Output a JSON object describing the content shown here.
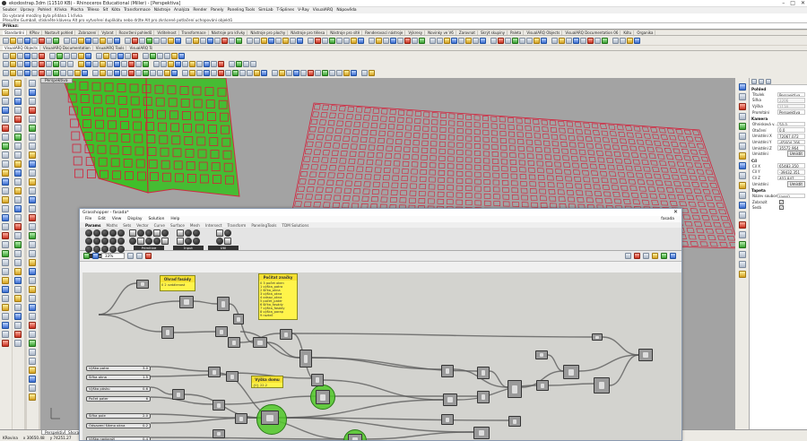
{
  "window": {
    "title": "ekodostrap.3dm (11510 KB) - Rhinoceros Educational (Miller) - [Perspektiva]",
    "controls": [
      "–",
      "□",
      "✕"
    ]
  },
  "menu": [
    "Soubor",
    "Úpravy",
    "Pohled",
    "Křivka",
    "Plocha",
    "Těleso",
    "Síť",
    "Kóta",
    "Transformace",
    "Nástroje",
    "Analýza",
    "Render",
    "Panely",
    "Paneling Tools",
    "SimLab",
    "T-Splines",
    "V-Ray",
    "VisualARQ",
    "Nápověda"
  ],
  "command": {
    "history": [
      "Do vybrané množiny byla přidána 1 křivka",
      "Přesuňte Gumball, stiskněte klávesu Alt pro vytvoření duplikátu nebo držte Alt pro zkrácené potlačení uchopování objektů"
    ],
    "prompt": "Příkaz:"
  },
  "tabs_row1": [
    "Standardní",
    "KPlov",
    "Nastavit pohled",
    "Zobrazení",
    "Vybrat",
    "Rozvržení pohledů",
    "Viditelnost",
    "Transformace",
    "Nástroje pro křivky",
    "Nástroje pro plochy",
    "Nástroje pro tělesa",
    "Nástroje pro sítě",
    "Renderovací nástroje",
    "Výkresy",
    "Novinky ve V6",
    "Zarovnat",
    "Skrýt skupiny",
    "Paleta",
    "VisualARQ Objects",
    "VisualARQ Documentation 06",
    "Kótu",
    "Organika"
  ],
  "tabs_row1_active": 0,
  "tabs_row2": [
    "VisualARQ Objects",
    "VisualARQ Documentation",
    "VisualARQ Tools",
    "VisualARQ Tools 06"
  ],
  "tabs_row2_active": 0,
  "viewport": {
    "label": "Perspektiva"
  },
  "properties": {
    "section_view": "Pohled",
    "rows_view": [
      {
        "k": "Titulek",
        "v": "Perspektiva",
        "disabled": false
      },
      {
        "k": "Šířka",
        "v": "2206",
        "disabled": true
      },
      {
        "k": "Výška",
        "v": "1130",
        "disabled": true
      },
      {
        "k": "Promítání",
        "v": "Perspektiva",
        "disabled": false
      }
    ],
    "section_camera": "Kamera",
    "rows_camera": [
      {
        "k": "Ohnisková v...",
        "v": "50.0"
      },
      {
        "k": "Otočení",
        "v": "0.0"
      },
      {
        "k": "Umístění X",
        "v": "72067.072"
      },
      {
        "k": "Umístění Y",
        "v": "-65604.206"
      },
      {
        "k": "Umístění Z",
        "v": "35572.964"
      }
    ],
    "place_button": "Umístit",
    "place_label": "Umístění",
    "section_target": "Cíl",
    "rows_target": [
      {
        "k": "Cíl X",
        "v": "65483.350"
      },
      {
        "k": "Cíl Y",
        "v": "-39432.351"
      },
      {
        "k": "Cíl Z",
        "v": "403.847"
      }
    ],
    "section_wallpaper": "Tapeta",
    "wallpaper_file_label": "Název souboru",
    "wallpaper_file_value": "(není)",
    "rows_wallpaper_checks": [
      {
        "k": "Zobrazit",
        "checked": true
      },
      {
        "k": "Šedá",
        "checked": true
      }
    ]
  },
  "status": {
    "tab_one": "Perspektiva",
    "tab_two": "Shora",
    "cplane": "KRovina",
    "x": "x 30650.48",
    "y": "y 74251.27"
  },
  "grasshopper": {
    "title": "Grasshopper - fasada*",
    "close": "✕",
    "menu": [
      "File",
      "Edit",
      "View",
      "Display",
      "Solution",
      "Help"
    ],
    "document": "fasada",
    "tabs": [
      "Params",
      "Maths",
      "Sets",
      "Vector",
      "Curve",
      "Surface",
      "Mesh",
      "Intersect",
      "Transform",
      "PanelingTools",
      "TDM Solutions"
    ],
    "active_tab": 0,
    "ribbon_groups": [
      "Geometry",
      "Primitive",
      "Input",
      "Util"
    ],
    "zoom": "33%",
    "panels": [
      {
        "title": "Ohraď fasády",
        "lines": [
          "0 2 vzdálenost"
        ]
      },
      {
        "title": "Počítat značky",
        "lines": [
          "0 3 počet oken",
          "1 výška_patra",
          "2 šířka_okna",
          "3 výška_okna",
          "4 odsaz_okna",
          "5 počet_pater",
          "6 šířka_fasády",
          "7 výška_fasády",
          "8 výška_parap",
          "9 rozteč"
        ]
      },
      {
        "title": "Výška domu",
        "lines": [
          "{0} 22.2"
        ]
      }
    ],
    "sliders": [
      {
        "label": "Výška patra",
        "value": "3.0"
      },
      {
        "label": "Šířka okna",
        "value": "1.5"
      },
      {
        "label": "Výška pásku",
        "value": "0.6"
      },
      {
        "label": "Počet pater",
        "value": "6"
      },
      {
        "label": "Šířka pole",
        "value": "2.0"
      },
      {
        "label": "Odsazení šikmo okna",
        "value": "0.2"
      },
      {
        "label": "Výška nadpraží",
        "value": "0.4"
      },
      {
        "label": "Délka",
        "value": "10"
      }
    ],
    "relay_labels": [
      "Area",
      "Area",
      "Area"
    ]
  },
  "colors": {
    "viewport_bg": "#a3a3a3",
    "mesh_red": "#d4203a",
    "mesh_green": "#3fbf2a",
    "gh_canvas": "#d3d3cf",
    "panel_yellow": "#fff44a"
  }
}
